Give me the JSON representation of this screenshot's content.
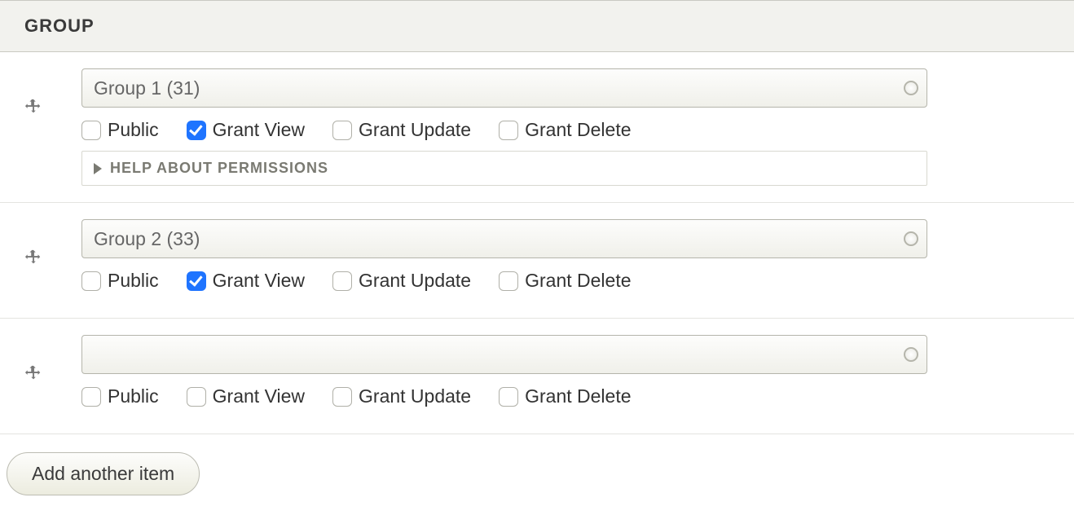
{
  "header": {
    "title": "GROUP"
  },
  "labels": {
    "public": "Public",
    "grant_view": "Grant View",
    "grant_update": "Grant Update",
    "grant_delete": "Grant Delete",
    "help": "HELP ABOUT PERMISSIONS",
    "add_button": "Add another item"
  },
  "rows": [
    {
      "select_value": "Group 1 (31)",
      "public": false,
      "grant_view": true,
      "grant_update": false,
      "grant_delete": false,
      "show_help": true
    },
    {
      "select_value": "Group 2 (33)",
      "public": false,
      "grant_view": true,
      "grant_update": false,
      "grant_delete": false,
      "show_help": false
    },
    {
      "select_value": "",
      "public": false,
      "grant_view": false,
      "grant_update": false,
      "grant_delete": false,
      "show_help": false
    }
  ]
}
